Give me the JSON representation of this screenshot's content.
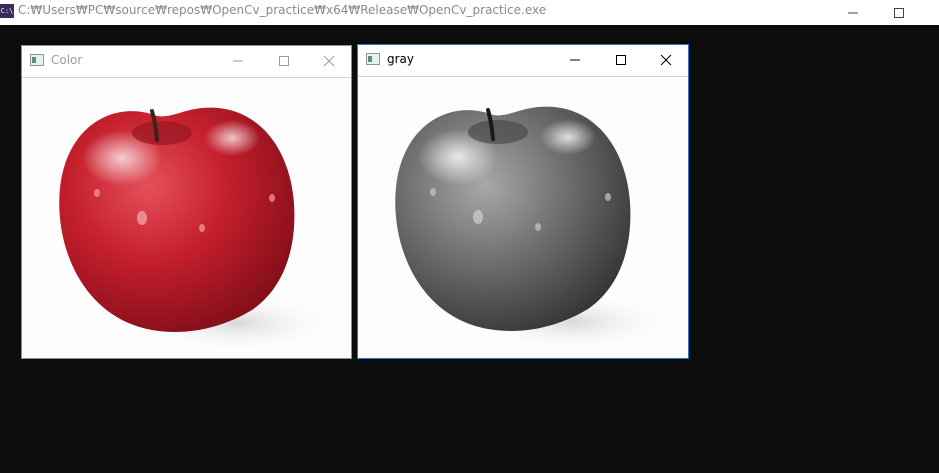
{
  "console": {
    "title": "C:₩Users₩PC₩source₩repos₩OpenCv_practice₩x64₩Release₩OpenCv_practice.exe",
    "icon": "console-app-icon",
    "icon_text": "C:\\"
  },
  "windows": [
    {
      "title": "Color",
      "active": false,
      "image": "red-apple-photo"
    },
    {
      "title": "gray",
      "active": true,
      "image": "grayscale-apple-photo"
    }
  ],
  "colors": {
    "background": "#0c0c0c",
    "active_border": "#1e78d6",
    "apple_red": "#c0202c"
  }
}
